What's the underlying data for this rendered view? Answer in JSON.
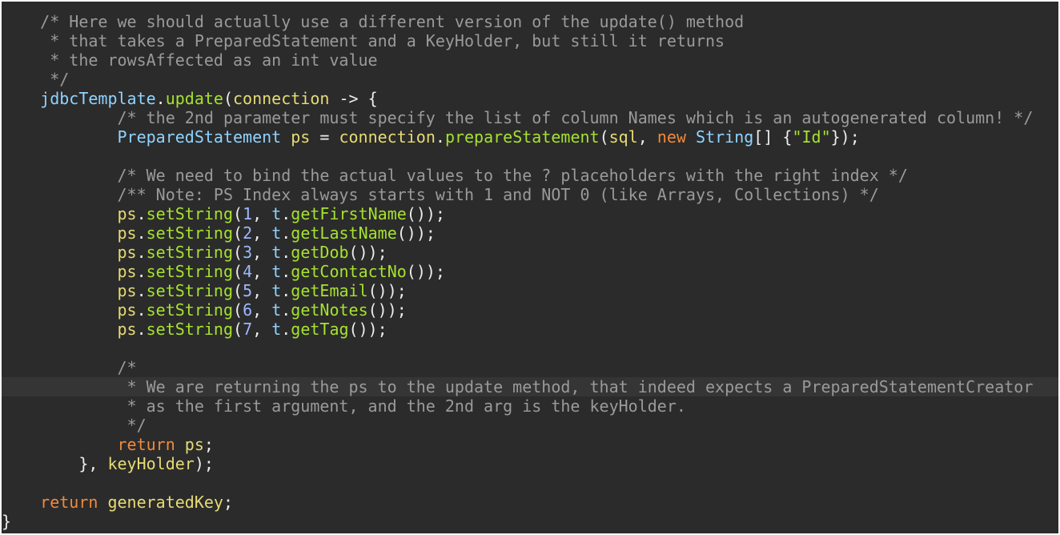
{
  "editor": {
    "colors": {
      "background": "#2b2b2b",
      "current_line": "#353535",
      "comment": "#9a9a9a",
      "method": "#a6e22e",
      "variable": "#e6db74",
      "type": "#8fd3ff",
      "keyword": "#f08a3c",
      "number": "#9db7ff",
      "string": "#a6e22e",
      "plain": "#ececec"
    },
    "current_line_index": 19,
    "lines": [
      [
        [
          "comment",
          "    /* Here we should actually use a different version of the update() method"
        ]
      ],
      [
        [
          "comment",
          "     * that takes a PreparedStatement and a KeyHolder, but still it returns"
        ]
      ],
      [
        [
          "comment",
          "     * the rowsAffected as an int value"
        ]
      ],
      [
        [
          "comment",
          "     */"
        ]
      ],
      [
        [
          "plain",
          "    "
        ],
        [
          "field",
          "jdbcTemplate"
        ],
        [
          "plain",
          "."
        ],
        [
          "method",
          "update"
        ],
        [
          "plain",
          "("
        ],
        [
          "var",
          "connection"
        ],
        [
          "plain",
          " -> {"
        ]
      ],
      [
        [
          "comment",
          "            /* the 2nd parameter must specify the list of column Names which is an autogenerated column! */"
        ]
      ],
      [
        [
          "plain",
          "            "
        ],
        [
          "type",
          "PreparedStatement"
        ],
        [
          "plain",
          " "
        ],
        [
          "var",
          "ps"
        ],
        [
          "plain",
          " = "
        ],
        [
          "var",
          "connection"
        ],
        [
          "plain",
          "."
        ],
        [
          "method",
          "prepareStatement"
        ],
        [
          "plain",
          "("
        ],
        [
          "var",
          "sql"
        ],
        [
          "plain",
          ", "
        ],
        [
          "keyword",
          "new"
        ],
        [
          "plain",
          " "
        ],
        [
          "type",
          "String"
        ],
        [
          "plain",
          "[] {"
        ],
        [
          "string",
          "\"Id\""
        ],
        [
          "plain",
          "});"
        ]
      ],
      [
        [
          "plain",
          ""
        ]
      ],
      [
        [
          "comment",
          "            /* We need to bind the actual values to the ? placeholders with the right index */"
        ]
      ],
      [
        [
          "comment",
          "            /** Note: PS Index always starts with 1 and NOT 0 (like Arrays, Collections) */"
        ]
      ],
      [
        [
          "plain",
          "            "
        ],
        [
          "var",
          "ps"
        ],
        [
          "plain",
          "."
        ],
        [
          "method",
          "setString"
        ],
        [
          "plain",
          "("
        ],
        [
          "number",
          "1"
        ],
        [
          "plain",
          ", "
        ],
        [
          "field",
          "t"
        ],
        [
          "plain",
          "."
        ],
        [
          "method",
          "getFirstName"
        ],
        [
          "plain",
          "());"
        ]
      ],
      [
        [
          "plain",
          "            "
        ],
        [
          "var",
          "ps"
        ],
        [
          "plain",
          "."
        ],
        [
          "method",
          "setString"
        ],
        [
          "plain",
          "("
        ],
        [
          "number",
          "2"
        ],
        [
          "plain",
          ", "
        ],
        [
          "field",
          "t"
        ],
        [
          "plain",
          "."
        ],
        [
          "method",
          "getLastName"
        ],
        [
          "plain",
          "());"
        ]
      ],
      [
        [
          "plain",
          "            "
        ],
        [
          "var",
          "ps"
        ],
        [
          "plain",
          "."
        ],
        [
          "method",
          "setString"
        ],
        [
          "plain",
          "("
        ],
        [
          "number",
          "3"
        ],
        [
          "plain",
          ", "
        ],
        [
          "field",
          "t"
        ],
        [
          "plain",
          "."
        ],
        [
          "method",
          "getDob"
        ],
        [
          "plain",
          "());"
        ]
      ],
      [
        [
          "plain",
          "            "
        ],
        [
          "var",
          "ps"
        ],
        [
          "plain",
          "."
        ],
        [
          "method",
          "setString"
        ],
        [
          "plain",
          "("
        ],
        [
          "number",
          "4"
        ],
        [
          "plain",
          ", "
        ],
        [
          "field",
          "t"
        ],
        [
          "plain",
          "."
        ],
        [
          "method",
          "getContactNo"
        ],
        [
          "plain",
          "());"
        ]
      ],
      [
        [
          "plain",
          "            "
        ],
        [
          "var",
          "ps"
        ],
        [
          "plain",
          "."
        ],
        [
          "method",
          "setString"
        ],
        [
          "plain",
          "("
        ],
        [
          "number",
          "5"
        ],
        [
          "plain",
          ", "
        ],
        [
          "field",
          "t"
        ],
        [
          "plain",
          "."
        ],
        [
          "method",
          "getEmail"
        ],
        [
          "plain",
          "());"
        ]
      ],
      [
        [
          "plain",
          "            "
        ],
        [
          "var",
          "ps"
        ],
        [
          "plain",
          "."
        ],
        [
          "method",
          "setString"
        ],
        [
          "plain",
          "("
        ],
        [
          "number",
          "6"
        ],
        [
          "plain",
          ", "
        ],
        [
          "field",
          "t"
        ],
        [
          "plain",
          "."
        ],
        [
          "method",
          "getNotes"
        ],
        [
          "plain",
          "());"
        ]
      ],
      [
        [
          "plain",
          "            "
        ],
        [
          "var",
          "ps"
        ],
        [
          "plain",
          "."
        ],
        [
          "method",
          "setString"
        ],
        [
          "plain",
          "("
        ],
        [
          "number",
          "7"
        ],
        [
          "plain",
          ", "
        ],
        [
          "field",
          "t"
        ],
        [
          "plain",
          "."
        ],
        [
          "method",
          "getTag"
        ],
        [
          "plain",
          "());"
        ]
      ],
      [
        [
          "plain",
          ""
        ]
      ],
      [
        [
          "comment",
          "            /*"
        ]
      ],
      [
        [
          "comment",
          "             * We are returning the ps to the update method, that indeed expects a PreparedStatementCreator"
        ]
      ],
      [
        [
          "comment",
          "             * as the first argument, and the 2nd arg is the keyHolder."
        ]
      ],
      [
        [
          "comment",
          "             */"
        ]
      ],
      [
        [
          "plain",
          "            "
        ],
        [
          "keyword",
          "return"
        ],
        [
          "plain",
          " "
        ],
        [
          "var",
          "ps"
        ],
        [
          "plain",
          ";"
        ]
      ],
      [
        [
          "plain",
          "        }, "
        ],
        [
          "var",
          "keyHolder"
        ],
        [
          "plain",
          ");"
        ]
      ],
      [
        [
          "plain",
          ""
        ]
      ],
      [
        [
          "plain",
          "    "
        ],
        [
          "keyword",
          "return"
        ],
        [
          "plain",
          " "
        ],
        [
          "var",
          "generatedKey"
        ],
        [
          "plain",
          ";"
        ]
      ],
      [
        [
          "plain",
          "}"
        ]
      ]
    ]
  }
}
